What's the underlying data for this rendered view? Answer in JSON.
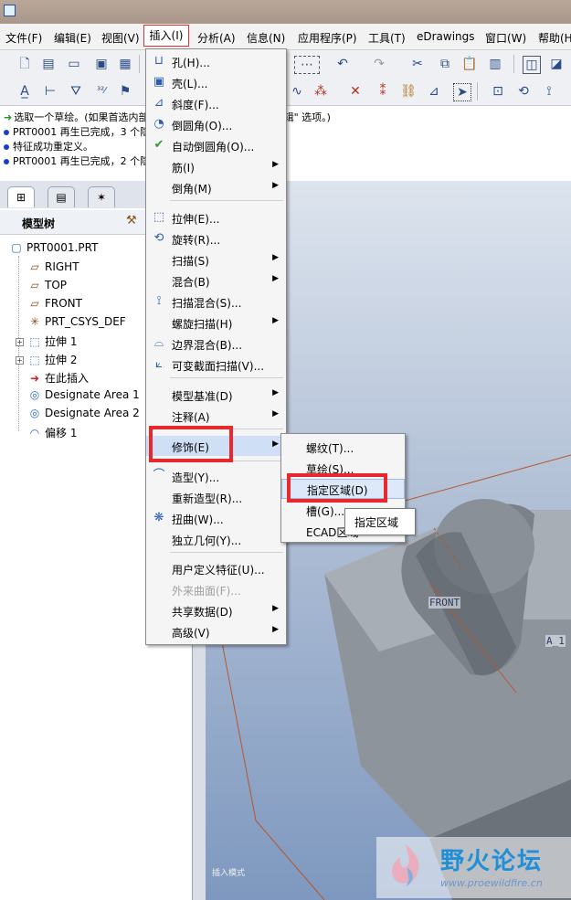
{
  "menubar": {
    "items": [
      "文件(F)",
      "编辑(E)",
      "视图(V)",
      "插入(I)",
      "分析(A)",
      "信息(N)",
      "应用程序(P)",
      "工具(T)",
      "eDrawings",
      "窗口(W)",
      "帮助(H)"
    ]
  },
  "messages": [
    {
      "icon": "green-arrow",
      "text": "选取一个草绘。(如果首选内部草绘，可在放置面板中找到\"编辑\" 选项。)"
    },
    {
      "icon": "blue-dot",
      "text": "PRT0001 再生已完成，3 个隐含特征。"
    },
    {
      "icon": "blue-dot",
      "text": "特征成功重定义。"
    },
    {
      "icon": "blue-dot",
      "text": "PRT0001 再生已完成，2 个隐含特征。"
    }
  ],
  "model_tree": {
    "title": "模型树",
    "root": "PRT0001.PRT",
    "items": [
      {
        "label": "RIGHT",
        "icon": "datum-plane-icon"
      },
      {
        "label": "TOP",
        "icon": "datum-plane-icon"
      },
      {
        "label": "FRONT",
        "icon": "datum-plane-icon"
      },
      {
        "label": "PRT_CSYS_DEF",
        "icon": "csys-icon"
      },
      {
        "label": "拉伸 1",
        "icon": "extrude-icon",
        "expandable": true
      },
      {
        "label": "拉伸 2",
        "icon": "extrude-icon",
        "expandable": true
      },
      {
        "label": "在此插入",
        "icon": "insert-here-arrow-icon"
      },
      {
        "label": "Designate Area 1",
        "icon": "designate-area-icon"
      },
      {
        "label": "Designate Area 2",
        "icon": "designate-area-icon"
      },
      {
        "label": "偏移 1",
        "icon": "offset-icon"
      }
    ]
  },
  "insert_menu": {
    "items": [
      {
        "label": "孔(H)...",
        "icon": "hole-icon"
      },
      {
        "label": "壳(L)...",
        "icon": "shell-icon"
      },
      {
        "label": "斜度(F)...",
        "icon": "draft-icon"
      },
      {
        "label": "倒圆角(O)...",
        "icon": "round-icon"
      },
      {
        "label": "自动倒圆角(O)...",
        "icon": "auto-round-icon"
      },
      {
        "label": "筋(I)",
        "submenu": true
      },
      {
        "label": "倒角(M)",
        "submenu": true
      },
      {
        "label": "拉伸(E)...",
        "icon": "extrude-icon"
      },
      {
        "label": "旋转(R)...",
        "icon": "revolve-icon"
      },
      {
        "label": "扫描(S)",
        "submenu": true
      },
      {
        "label": "混合(B)",
        "submenu": true
      },
      {
        "label": "扫描混合(S)...",
        "icon": "swept-blend-icon"
      },
      {
        "label": "螺旋扫描(H)",
        "submenu": true
      },
      {
        "label": "边界混合(B)...",
        "icon": "boundary-blend-icon"
      },
      {
        "label": "可变截面扫描(V)...",
        "icon": "variable-sweep-icon"
      },
      {
        "label": "模型基准(D)",
        "submenu": true
      },
      {
        "label": "注释(A)",
        "submenu": true
      },
      {
        "label": "修饰(E)",
        "submenu": true,
        "highlighted": true
      },
      {
        "label": "造型(Y)...",
        "icon": "style-icon"
      },
      {
        "label": "重新造型(R)..."
      },
      {
        "label": "扭曲(W)...",
        "icon": "warp-icon"
      },
      {
        "label": "独立几何(Y)..."
      },
      {
        "label": "用户定义特征(U)..."
      },
      {
        "label": "外来曲面(F)...",
        "disabled": true
      },
      {
        "label": "共享数据(D)",
        "submenu": true
      },
      {
        "label": "高级(V)",
        "submenu": true
      }
    ]
  },
  "cosmetic_submenu": {
    "items": [
      "螺纹(T)...",
      "草绘(S)...",
      "指定区域(D)",
      "槽(G)...",
      "ECAD区域"
    ],
    "selected": "指定区域(D)",
    "tooltip": "指定区域"
  },
  "viewport": {
    "datum_labels": [
      "FRONT",
      "A_1"
    ],
    "status_hint": "插入模式"
  },
  "watermark": {
    "title": "野火论坛",
    "url": "www.proewildfire.cn"
  },
  "colors": {
    "highlight_red": "#e8282c",
    "menu_hover": "#cfe0f6",
    "watermark_blue": "#1f8fd8"
  }
}
